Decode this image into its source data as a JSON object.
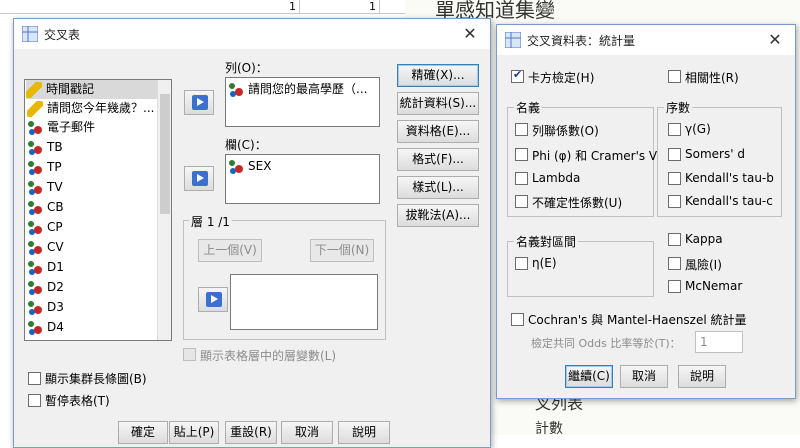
{
  "background": {
    "grid_values": [
      "1",
      "1"
    ],
    "handwriting_top": "單感知道集變",
    "handwriting_bottom1": "叉列表",
    "handwriting_bottom2": "計數"
  },
  "crosstab_dialog": {
    "title": "交叉表",
    "variables": [
      "時間戳記",
      "請問您今年幾歲？...",
      "電子郵件",
      "TB",
      "TP",
      "TV",
      "CB",
      "CP",
      "CV",
      "D1",
      "D2",
      "D3",
      "D4"
    ],
    "row_label": "列(O)：",
    "row_vars": [
      "請問您的最高學歷（..."
    ],
    "col_label": "欄(C)：",
    "col_vars": [
      "SEX"
    ],
    "layer_label": "層 1 /1",
    "prev_button": "上一個(V)",
    "next_button": "下一個(N)",
    "show_layer_vars": "顯示表格層中的層變數(L)",
    "show_clustered_bar": "顯示集群長條圖(B)",
    "suppress_tables": "暫停表格(T)",
    "side_buttons": [
      "精確(X)...",
      "統計資料(S)...",
      "資料格(E)...",
      "格式(F)...",
      "樣式(L)...",
      "拔靴法(A)..."
    ],
    "bottom_buttons": [
      "確定",
      "貼上(P)",
      "重設(R)",
      "取消",
      "說明"
    ]
  },
  "stats_dialog": {
    "title": "交叉資料表：統計量",
    "chisq": "卡方檢定(H)",
    "correlations": "相關性(R)",
    "nominal_title": "名義",
    "nominal_items": [
      "列聯係數(O)",
      "Phi (φ) 和 Cramer's V",
      "Lambda",
      "不確定性係數(U)"
    ],
    "ordinal_title": "序數",
    "ordinal_items": [
      "γ(G)",
      "Somers' d",
      "Kendall's tau-b",
      "Kendall's tau-c"
    ],
    "nom_int_title": "名義對區間",
    "eta": "η(E)",
    "kappa": "Kappa",
    "risk": "風險(I)",
    "mcnemar": "McNemar",
    "cochran": "Cochran's 與 Mantel-Haenszel 統計量",
    "odds_label": "檢定共同 Odds 比率等於(T)：",
    "odds_value": "1",
    "continue_button": "繼續(C)",
    "cancel_button": "取消",
    "help_button": "說明"
  }
}
